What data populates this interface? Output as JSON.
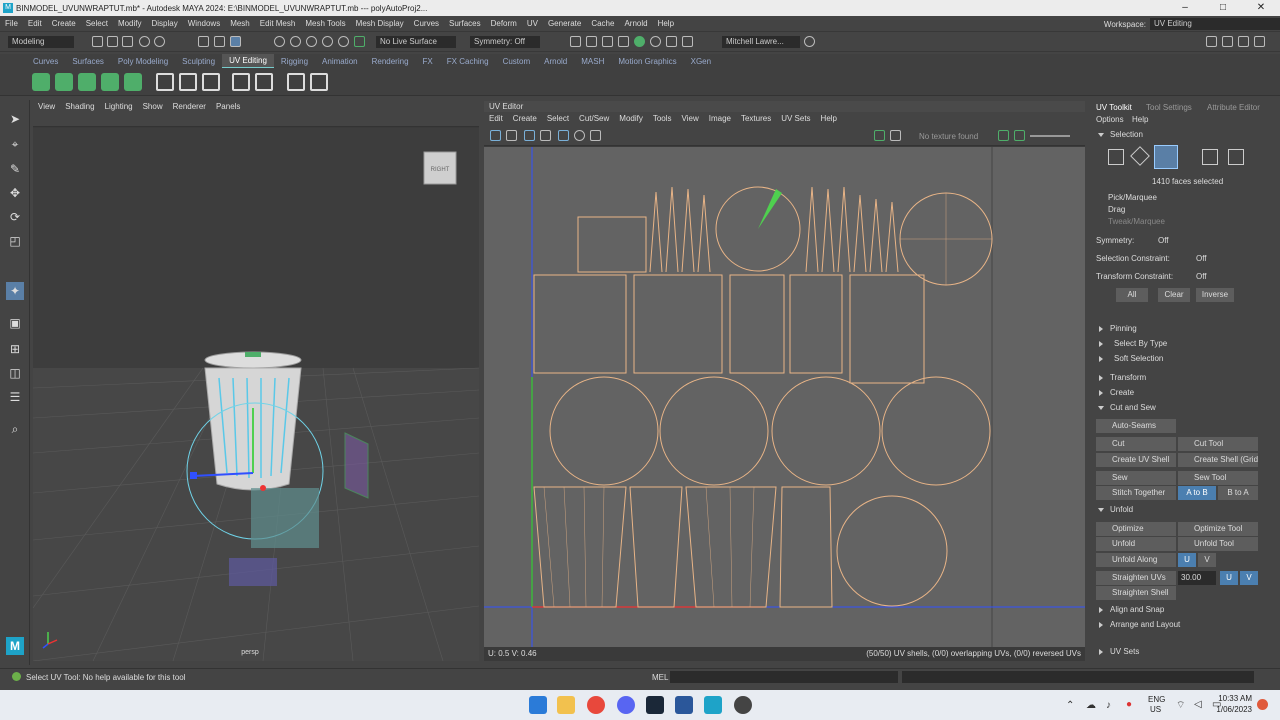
{
  "window": {
    "title": "BINMODEL_UVUNWRAPTUT.mb* - Autodesk MAYA 2024: E:\\BINMODEL_UVUNWRAPTUT.mb  ---  polyAutoProj2..."
  },
  "menubar": {
    "items": [
      "File",
      "Edit",
      "Create",
      "Select",
      "Modify",
      "Display",
      "Windows",
      "Mesh",
      "Edit Mesh",
      "Mesh Tools",
      "Mesh Display",
      "Curves",
      "Surfaces",
      "Deform",
      "UV",
      "Generate",
      "Cache",
      "Arnold",
      "Help"
    ],
    "workspace_label": "Workspace:",
    "workspace_value": "UV Editing"
  },
  "statusline": {
    "mode": "Modeling",
    "live_surface": "No Live Surface",
    "symmetry": "Symmetry: Off",
    "user": "Mitchell Lawre..."
  },
  "shelf": {
    "tabs": [
      "Curves",
      "Surfaces",
      "Poly Modeling",
      "Sculpting",
      "UV Editing",
      "Rigging",
      "Animation",
      "Rendering",
      "FX",
      "FX Caching",
      "Custom",
      "Arnold",
      "MASH",
      "Motion Graphics",
      "XGen"
    ],
    "active": "UV Editing"
  },
  "viewport": {
    "menu": [
      "View",
      "Shading",
      "Lighting",
      "Show",
      "Renderer",
      "Panels"
    ],
    "camera_label": "persp",
    "viewcube_label": "RIGHT"
  },
  "uv_editor": {
    "title": "UV Editor",
    "menu": [
      "Edit",
      "Create",
      "Select",
      "Cut/Sew",
      "Modify",
      "Tools",
      "View",
      "Image",
      "Textures",
      "UV Sets",
      "Help"
    ],
    "texture_label": "No texture found",
    "status_left": "U:  0.5  V:  0.46",
    "status_right": "(50/50) UV shells, (0/0) overlapping UVs, (0/0) reversed UVs"
  },
  "toolkit": {
    "tabs": [
      "UV Toolkit",
      "Tool Settings",
      "Attribute Editor"
    ],
    "menu": [
      "Options",
      "Help"
    ],
    "selection_header": "Selection",
    "faces_selected": "1410 faces selected",
    "pick_options": [
      "Pick/Marquee",
      "Drag",
      "Tweak/Marquee"
    ],
    "symmetry_label": "Symmetry:",
    "symmetry_value": "Off",
    "sel_constraint_label": "Selection Constraint:",
    "sel_constraint_value": "Off",
    "xform_constraint_label": "Transform Constraint:",
    "xform_constraint_value": "Off",
    "buttons": [
      "All",
      "Clear",
      "Inverse"
    ],
    "subsections": [
      "Pinning",
      "Select By Type",
      "Soft Selection"
    ],
    "transform_header": "Transform",
    "create_header": "Create",
    "cutsew_header": "Cut and Sew",
    "auto_seams": "Auto-Seams",
    "cut": "Cut",
    "cut_tool": "Cut Tool",
    "create_uv_shell": "Create UV Shell",
    "create_shell_grid": "Create Shell (Grid)",
    "sew": "Sew",
    "sew_tool": "Sew Tool",
    "stitch_together": "Stitch Together",
    "a_to_b": "A to B",
    "b_to_a": "B to A",
    "unfold_header": "Unfold",
    "optimize": "Optimize",
    "optimize_tool": "Optimize Tool",
    "unfold": "Unfold",
    "unfold_tool": "Unfold Tool",
    "unfold_along": "Unfold Along",
    "u": "U",
    "v": "V",
    "straighten_uvs": "Straighten UVs",
    "straighten_value": "30.00",
    "straighten_shell": "Straighten Shell",
    "align_snap": "Align and Snap",
    "arrange_layout": "Arrange and Layout",
    "uv_sets": "UV Sets"
  },
  "helpline": {
    "text": "Select UV Tool: No help available for this tool",
    "mel_label": "MEL"
  },
  "taskbar": {
    "lang_top": "ENG",
    "lang_bottom": "US",
    "time": "10:33 AM",
    "date": "1/06/2023"
  },
  "colors": {
    "accent": "#4fae6a",
    "uv_wire": "#e8b487",
    "selection_blue": "#4b7fb0"
  }
}
